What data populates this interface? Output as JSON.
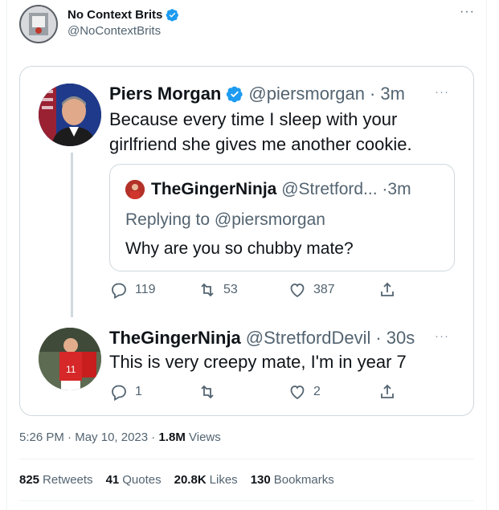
{
  "author": {
    "name": "No Context Brits",
    "handle": "@NoContextBrits",
    "verified": true,
    "more_icon": "more-horizontal-icon"
  },
  "screenshot": {
    "main_tweet": {
      "name": "Piers Morgan",
      "handle": "@piersmorgan",
      "separator": "·",
      "time": "3m",
      "text_line1": "Because every time I sleep with your",
      "text_line2": "girlfriend she gives me another cookie.",
      "quoted": {
        "name": "TheGingerNinja",
        "handle": "@Stretford...",
        "separator": "·",
        "time": "3m",
        "replying_to": "Replying to @piersmorgan",
        "text": "Why are you so chubby mate?"
      },
      "actions": {
        "replies": "119",
        "retweets": "53",
        "likes": "387"
      }
    },
    "reply_tweet": {
      "name": "TheGingerNinja",
      "handle": "@StretfordDevil",
      "separator": "·",
      "time": "30s",
      "text": "This is very creepy mate, I'm in year 7",
      "actions": {
        "replies": "1",
        "retweets": "",
        "likes": "2"
      }
    }
  },
  "meta": {
    "time": "5:26 PM",
    "separator": "·",
    "date": "May 10, 2023",
    "separator2": "·",
    "views_count": "1.8M",
    "views_label": "Views"
  },
  "stats": {
    "retweets_count": "825",
    "retweets_label": "Retweets",
    "quotes_count": "41",
    "quotes_label": "Quotes",
    "likes_count": "20.8K",
    "likes_label": "Likes",
    "bookmarks_count": "130",
    "bookmarks_label": "Bookmarks"
  },
  "colors": {
    "verified_blue": "#1d9bf0",
    "text_secondary": "#536471",
    "border": "#cfd9de"
  }
}
